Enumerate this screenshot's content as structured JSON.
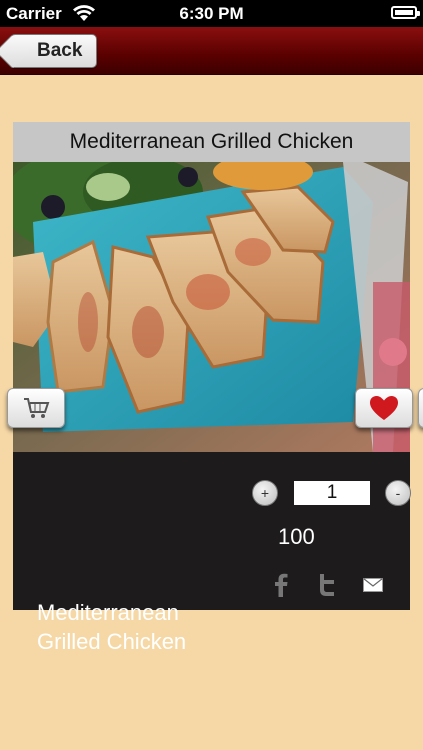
{
  "status_bar": {
    "carrier": "Carrier",
    "time": "6:30 PM"
  },
  "nav": {
    "back_label": "Back"
  },
  "dish": {
    "title": "Mediterranean Grilled Chicken",
    "name": "Mediterranean Grilled Chicken",
    "quantity": "1",
    "price": "100"
  },
  "controls": {
    "plus": "+",
    "minus": "-"
  },
  "icons": {
    "cart": "cart-icon",
    "favorite": "heart-icon",
    "facebook": "facebook-icon",
    "twitter": "twitter-icon",
    "mail": "mail-icon"
  },
  "colors": {
    "page_background": "#f6d8a6",
    "nav_bar": "#5a0000",
    "card_background": "#1d1b1b",
    "title_strip": "#c6c6c6",
    "heart": "#d0181f"
  }
}
